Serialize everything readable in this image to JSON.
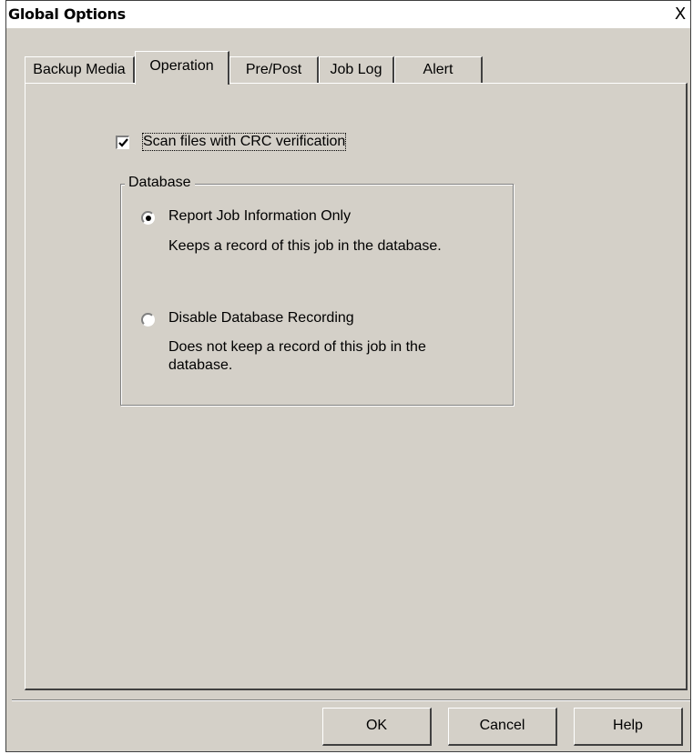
{
  "window": {
    "title": "Global Options",
    "close_symbol": "X"
  },
  "tabs": [
    {
      "label": "Backup Media"
    },
    {
      "label": "Operation"
    },
    {
      "label": "Pre/Post"
    },
    {
      "label": "Job Log"
    },
    {
      "label": "Alert"
    }
  ],
  "active_tab": "Operation",
  "operation": {
    "crc_checkbox": {
      "label": "Scan files with CRC verification",
      "checked": true
    },
    "database_group": {
      "title": "Database",
      "options": [
        {
          "label": "Report Job Information Only",
          "description": "Keeps a record of this job in the database.",
          "selected": true
        },
        {
          "label": "Disable Database Recording",
          "description": "Does not keep a record of this job in the database.",
          "selected": false
        }
      ]
    }
  },
  "buttons": {
    "ok": "OK",
    "cancel": "Cancel",
    "help": "Help"
  }
}
